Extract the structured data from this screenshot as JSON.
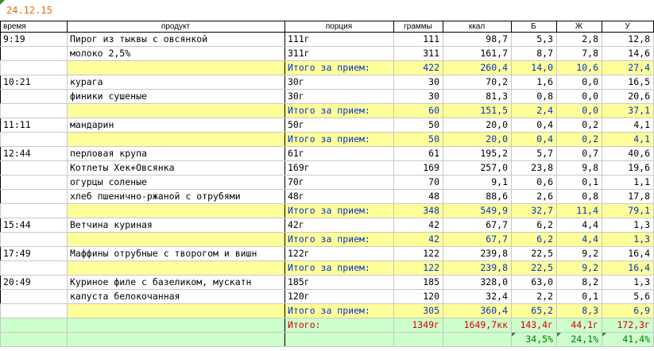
{
  "date": "24.12.15",
  "headers": {
    "time": "время",
    "product": "продукт",
    "portion": "порция",
    "grams": "граммы",
    "kcal": "ккал",
    "b": "Б",
    "zh": "Ж",
    "u": "У"
  },
  "meals": [
    {
      "time": "9:19",
      "items": [
        {
          "product": "Пирог из тыквы с овсянкой",
          "portion": "111г",
          "grams": "111",
          "kcal": "98,7",
          "b": "5,3",
          "zh": "2,8",
          "u": "12,8"
        },
        {
          "product": "молоко 2,5%",
          "portion": "311г",
          "grams": "311",
          "kcal": "161,7",
          "b": "8,7",
          "zh": "7,8",
          "u": "14,6"
        }
      ],
      "subtotal": {
        "label": "Итого за прием:",
        "grams": "422",
        "kcal": "260,4",
        "b": "14,0",
        "zh": "10,6",
        "u": "27,4"
      }
    },
    {
      "time": "10:21",
      "items": [
        {
          "product": "курага",
          "portion": "30г",
          "grams": "30",
          "kcal": "70,2",
          "b": "1,6",
          "zh": "0,0",
          "u": "16,5"
        },
        {
          "product": "финики сушеные",
          "portion": "30г",
          "grams": "30",
          "kcal": "81,3",
          "b": "0,8",
          "zh": "0,0",
          "u": "20,6"
        }
      ],
      "subtotal": {
        "label": "Итого за прием:",
        "grams": "60",
        "kcal": "151,5",
        "b": "2,4",
        "zh": "0,0",
        "u": "37,1"
      }
    },
    {
      "time": "11:11",
      "items": [
        {
          "product": "мандарин",
          "portion": "50г",
          "grams": "50",
          "kcal": "20,0",
          "b": "0,4",
          "zh": "0,2",
          "u": "4,1"
        }
      ],
      "subtotal": {
        "label": "Итого за прием:",
        "grams": "50",
        "kcal": "20,0",
        "b": "0,4",
        "zh": "0,2",
        "u": "4,1"
      }
    },
    {
      "time": "12:44",
      "items": [
        {
          "product": "перловая крупа",
          "portion": "61г",
          "grams": "61",
          "kcal": "195,2",
          "b": "5,7",
          "zh": "0,7",
          "u": "40,6"
        },
        {
          "product": "Котлеты Хек+Овсянка",
          "portion": "169г",
          "grams": "169",
          "kcal": "257,0",
          "b": "23,8",
          "zh": "9,8",
          "u": "19,6"
        },
        {
          "product": "огурцы соленые",
          "portion": "70г",
          "grams": "70",
          "kcal": "9,1",
          "b": "0,6",
          "zh": "0,1",
          "u": "1,1"
        },
        {
          "product": "хлеб пшенично-ржаной с отрубями",
          "portion": "48г",
          "grams": "48",
          "kcal": "88,6",
          "b": "2,6",
          "zh": "0,8",
          "u": "17,8"
        }
      ],
      "subtotal": {
        "label": "Итого за прием:",
        "grams": "348",
        "kcal": "549,9",
        "b": "32,7",
        "zh": "11,4",
        "u": "79,1"
      }
    },
    {
      "time": "15:44",
      "items": [
        {
          "product": "Ветчина куриная",
          "portion": "42г",
          "grams": "42",
          "kcal": "67,7",
          "b": "6,2",
          "zh": "4,4",
          "u": "1,3"
        }
      ],
      "subtotal": {
        "label": "Итого за прием:",
        "grams": "42",
        "kcal": "67,7",
        "b": "6,2",
        "zh": "4,4",
        "u": "1,3"
      }
    },
    {
      "time": "17:49",
      "items": [
        {
          "product": "Маффины отрубные с творогом и вишн",
          "portion": "122г",
          "grams": "122",
          "kcal": "239,8",
          "b": "22,5",
          "zh": "9,2",
          "u": "16,4"
        }
      ],
      "subtotal": {
        "label": "Итого за прием:",
        "grams": "122",
        "kcal": "239,8",
        "b": "22,5",
        "zh": "9,2",
        "u": "16,4"
      }
    },
    {
      "time": "20:49",
      "items": [
        {
          "product": "Куриное филе с базеликом, мускатн",
          "portion": "185г",
          "grams": "185",
          "kcal": "328,0",
          "b": "63,0",
          "zh": "8,2",
          "u": "1,3"
        },
        {
          "product": "капуста белокочанная",
          "portion": "120г",
          "grams": "120",
          "kcal": "32,4",
          "b": "2,2",
          "zh": "0,1",
          "u": "5,6"
        }
      ],
      "subtotal": {
        "label": "Итого за прием:",
        "grams": "305",
        "kcal": "360,4",
        "b": "65,2",
        "zh": "8,3",
        "u": "6,9"
      }
    }
  ],
  "total": {
    "label": "Итого:",
    "grams": "1349г",
    "kcal": "1649,7кк",
    "b": "143,4г",
    "zh": "44,1г",
    "u": "172,3г"
  },
  "percent": {
    "b": "34,5%",
    "zh": "24,1%",
    "u": "41,4%"
  },
  "colors": {
    "date": "#e36c0a",
    "subtotal_bg": "#ffff99",
    "subtotal_text": "#0033cc",
    "total_bg": "#ccffcc",
    "total_text": "#e00000",
    "percent_text": "#007a00"
  }
}
